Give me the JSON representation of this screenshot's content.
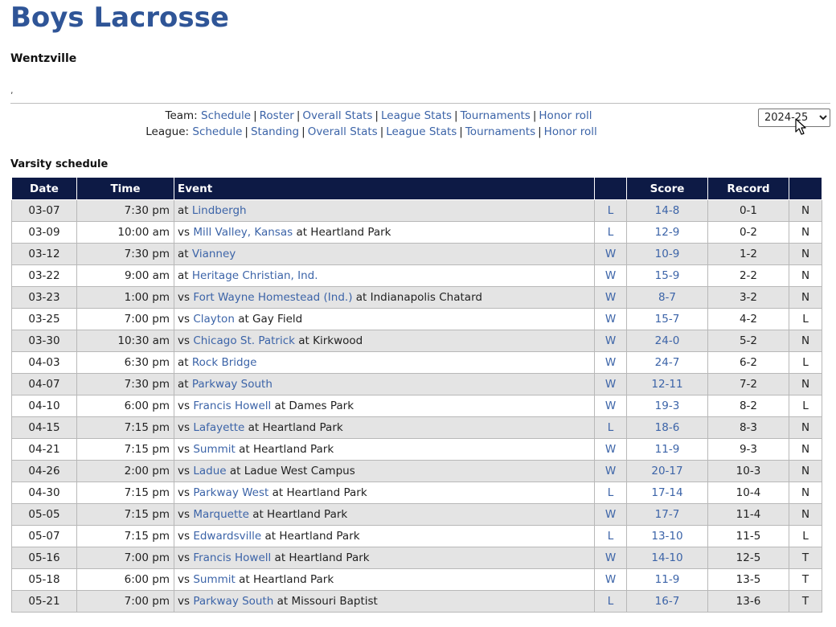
{
  "page": {
    "title": "Boys Lacrosse",
    "school": "Wentzville",
    "small_mark": ","
  },
  "nav": {
    "team_label": "Team:",
    "team_links": [
      "Schedule",
      "Roster",
      "Overall Stats",
      "League Stats",
      "Tournaments",
      "Honor roll"
    ],
    "league_label": "League:",
    "league_links": [
      "Schedule",
      "Standing",
      "Overall Stats",
      "League Stats",
      "Tournaments",
      "Honor roll"
    ],
    "separator": "|"
  },
  "season_select": {
    "selected": "2024-25"
  },
  "schedule": {
    "title": "Varsity schedule",
    "headers": {
      "date": "Date",
      "time": "Time",
      "event": "Event",
      "result": "",
      "score": "Score",
      "record": "Record",
      "type": ""
    },
    "rows": [
      {
        "date": "03-07",
        "time": "7:30 pm",
        "prefix": "at",
        "opponent": "Lindbergh",
        "location": "",
        "result": "L",
        "score": "14-8",
        "record": "0-1",
        "type": "N"
      },
      {
        "date": "03-09",
        "time": "10:00 am",
        "prefix": "vs",
        "opponent": "Mill Valley, Kansas",
        "location": "at Heartland Park",
        "result": "L",
        "score": "12-9",
        "record": "0-2",
        "type": "N"
      },
      {
        "date": "03-12",
        "time": "7:30 pm",
        "prefix": "at",
        "opponent": "Vianney",
        "location": "",
        "result": "W",
        "score": "10-9",
        "record": "1-2",
        "type": "N"
      },
      {
        "date": "03-22",
        "time": "9:00 am",
        "prefix": "at",
        "opponent": "Heritage Christian, Ind.",
        "location": "",
        "result": "W",
        "score": "15-9",
        "record": "2-2",
        "type": "N"
      },
      {
        "date": "03-23",
        "time": "1:00 pm",
        "prefix": "vs",
        "opponent": "Fort Wayne Homestead (Ind.)",
        "location": "at Indianapolis Chatard",
        "result": "W",
        "score": "8-7",
        "record": "3-2",
        "type": "N"
      },
      {
        "date": "03-25",
        "time": "7:00 pm",
        "prefix": "vs",
        "opponent": "Clayton",
        "location": "at Gay Field",
        "result": "W",
        "score": "15-7",
        "record": "4-2",
        "type": "L"
      },
      {
        "date": "03-30",
        "time": "10:30 am",
        "prefix": "vs",
        "opponent": "Chicago St. Patrick",
        "location": "at Kirkwood",
        "result": "W",
        "score": "24-0",
        "record": "5-2",
        "type": "N"
      },
      {
        "date": "04-03",
        "time": "6:30 pm",
        "prefix": "at",
        "opponent": "Rock Bridge",
        "location": "",
        "result": "W",
        "score": "24-7",
        "record": "6-2",
        "type": "L"
      },
      {
        "date": "04-07",
        "time": "7:30 pm",
        "prefix": "at",
        "opponent": "Parkway South",
        "location": "",
        "result": "W",
        "score": "12-11",
        "record": "7-2",
        "type": "N"
      },
      {
        "date": "04-10",
        "time": "6:00 pm",
        "prefix": "vs",
        "opponent": "Francis Howell",
        "location": "at Dames Park",
        "result": "W",
        "score": "19-3",
        "record": "8-2",
        "type": "L"
      },
      {
        "date": "04-15",
        "time": "7:15 pm",
        "prefix": "vs",
        "opponent": "Lafayette",
        "location": "at Heartland Park",
        "result": "L",
        "score": "18-6",
        "record": "8-3",
        "type": "N"
      },
      {
        "date": "04-21",
        "time": "7:15 pm",
        "prefix": "vs",
        "opponent": "Summit",
        "location": "at Heartland Park",
        "result": "W",
        "score": "11-9",
        "record": "9-3",
        "type": "N"
      },
      {
        "date": "04-26",
        "time": "2:00 pm",
        "prefix": "vs",
        "opponent": "Ladue",
        "location": "at Ladue West Campus",
        "result": "W",
        "score": "20-17",
        "record": "10-3",
        "type": "N"
      },
      {
        "date": "04-30",
        "time": "7:15 pm",
        "prefix": "vs",
        "opponent": "Parkway West",
        "location": "at Heartland Park",
        "result": "L",
        "score": "17-14",
        "record": "10-4",
        "type": "N"
      },
      {
        "date": "05-05",
        "time": "7:15 pm",
        "prefix": "vs",
        "opponent": "Marquette",
        "location": "at Heartland Park",
        "result": "W",
        "score": "17-7",
        "record": "11-4",
        "type": "N"
      },
      {
        "date": "05-07",
        "time": "7:15 pm",
        "prefix": "vs",
        "opponent": "Edwardsville",
        "location": "at Heartland Park",
        "result": "L",
        "score": "13-10",
        "record": "11-5",
        "type": "L"
      },
      {
        "date": "05-16",
        "time": "7:00 pm",
        "prefix": "vs",
        "opponent": "Francis Howell",
        "location": "at Heartland Park",
        "result": "W",
        "score": "14-10",
        "record": "12-5",
        "type": "T"
      },
      {
        "date": "05-18",
        "time": "6:00 pm",
        "prefix": "vs",
        "opponent": "Summit",
        "location": "at Heartland Park",
        "result": "W",
        "score": "11-9",
        "record": "13-5",
        "type": "T"
      },
      {
        "date": "05-21",
        "time": "7:00 pm",
        "prefix": "vs",
        "opponent": "Parkway South",
        "location": "at Missouri Baptist",
        "result": "L",
        "score": "16-7",
        "record": "13-6",
        "type": "T"
      }
    ]
  },
  "icons": {
    "cursor": "mouse-pointer-icon"
  },
  "colors": {
    "title": "#2f5597",
    "link": "#3c64a8",
    "header_bg": "#0d1a45",
    "row_alt": "#e4e4e4"
  }
}
